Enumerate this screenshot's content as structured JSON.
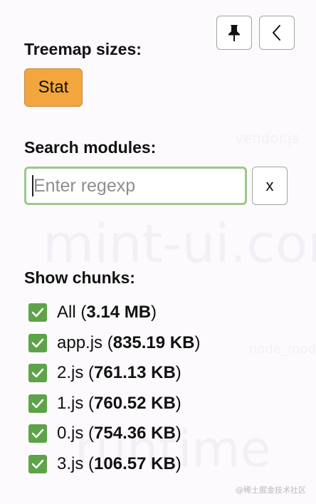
{
  "background_text": {
    "large_1": "mint-ui.com",
    "large_2": "runtime",
    "small_1": "vendor.js",
    "small_2": "node_modules"
  },
  "toolbar": {
    "pin_icon": "pushpin-icon",
    "collapse_icon": "chevron-left-icon"
  },
  "treemap": {
    "title": "Treemap sizes:",
    "stat_label": "Stat",
    "accent": "#f3a63d"
  },
  "search": {
    "title": "Search modules:",
    "placeholder": "Enter regexp",
    "value": "",
    "clear_label": "x",
    "focus_color": "#9cc78a"
  },
  "chunks": {
    "title": "Show chunks:",
    "check_color": "#5da348",
    "items": [
      {
        "name": "All",
        "size": "3.14 MB",
        "checked": true
      },
      {
        "name": "app.js",
        "size": "835.19 KB",
        "checked": true
      },
      {
        "name": "2.js",
        "size": "761.13 KB",
        "checked": true
      },
      {
        "name": "1.js",
        "size": "760.52 KB",
        "checked": true
      },
      {
        "name": "0.js",
        "size": "754.36 KB",
        "checked": true
      },
      {
        "name": "3.js",
        "size": "106.57 KB",
        "checked": true
      }
    ]
  },
  "watermark": "@稀土掘金技术社区"
}
